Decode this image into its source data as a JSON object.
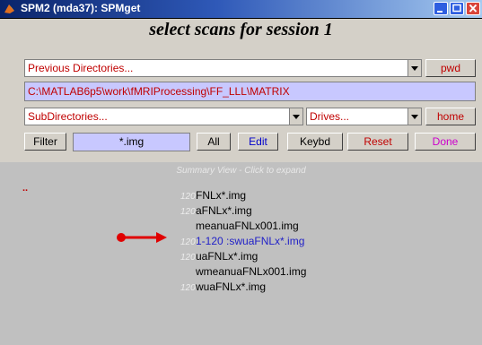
{
  "window": {
    "title": "SPM2 (mda37): SPMget",
    "icon": "matlab-icon",
    "controls": [
      "minimize-icon",
      "maximize-icon",
      "close-icon"
    ]
  },
  "heading": "select scans for session 1",
  "previous_directories": {
    "label": "Previous Directories..."
  },
  "buttons": {
    "pwd": "pwd",
    "home": "home",
    "filter": "Filter",
    "all": "All",
    "edit": "Edit",
    "keybd": "Keybd",
    "reset": "Reset",
    "done": "Done"
  },
  "current_path": "C:\\MATLAB6p5\\work\\fMRIProcessing\\FF_LLL\\MATRIX",
  "subdirectories": {
    "label": "SubDirectories..."
  },
  "drives": {
    "label": "Drives..."
  },
  "filter_value": "*.img",
  "summary_view": "Summary View - Click to expand",
  "red_marker": "..",
  "file_list": [
    {
      "count": "120",
      "name": "FNLx*.img",
      "selected": false
    },
    {
      "count": "120",
      "name": "aFNLx*.img",
      "selected": false
    },
    {
      "count": "",
      "name": "meanuaFNLx001.img",
      "selected": false
    },
    {
      "count": "120",
      "name": "1-120 :swuaFNLx*.img",
      "selected": true
    },
    {
      "count": "120",
      "name": "uaFNLx*.img",
      "selected": false
    },
    {
      "count": "",
      "name": "wmeanuaFNLx001.img",
      "selected": false
    },
    {
      "count": "120",
      "name": "wuaFNLx*.img",
      "selected": false
    }
  ],
  "colors": {
    "red_label": "#c00000",
    "edit_blue": "#0000cc",
    "done_magenta": "#cc00cc",
    "field_lavender": "#c8c8ff",
    "selected_file": "#1f1fc8",
    "annotation_arrow": "#e00000"
  }
}
